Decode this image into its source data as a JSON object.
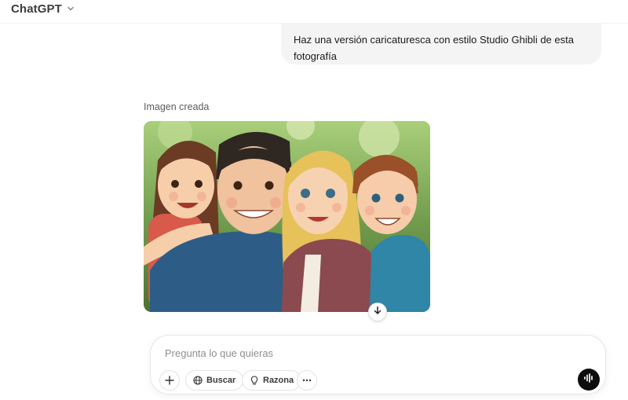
{
  "header": {
    "model_name": "ChatGPT",
    "switcher_icon": "chevron-down-icon"
  },
  "conversation": {
    "user_message": "Haz una versión caricaturesca con estilo Studio Ghibli de esta fotografía",
    "assistant": {
      "image_caption": "Imagen creada",
      "image_subject": "ghibli-style-family-portrait",
      "download_icon": "arrow-down-icon"
    }
  },
  "composer": {
    "placeholder": "Pregunta lo que quieras",
    "value": "",
    "tools": [
      {
        "icon": "plus-icon",
        "label": ""
      },
      {
        "icon": "globe-icon",
        "label": "Buscar"
      },
      {
        "icon": "lightbulb-icon",
        "label": "Razona"
      },
      {
        "icon": "more-icon",
        "label": ""
      }
    ],
    "voice_icon": "voice-waveform-icon"
  },
  "colors": {
    "bubble_bg": "#f4f4f4",
    "voice_button_bg": "#0d0d0d",
    "muted_text": "#5d5d5d",
    "placeholder_text": "#8f8f8f"
  }
}
